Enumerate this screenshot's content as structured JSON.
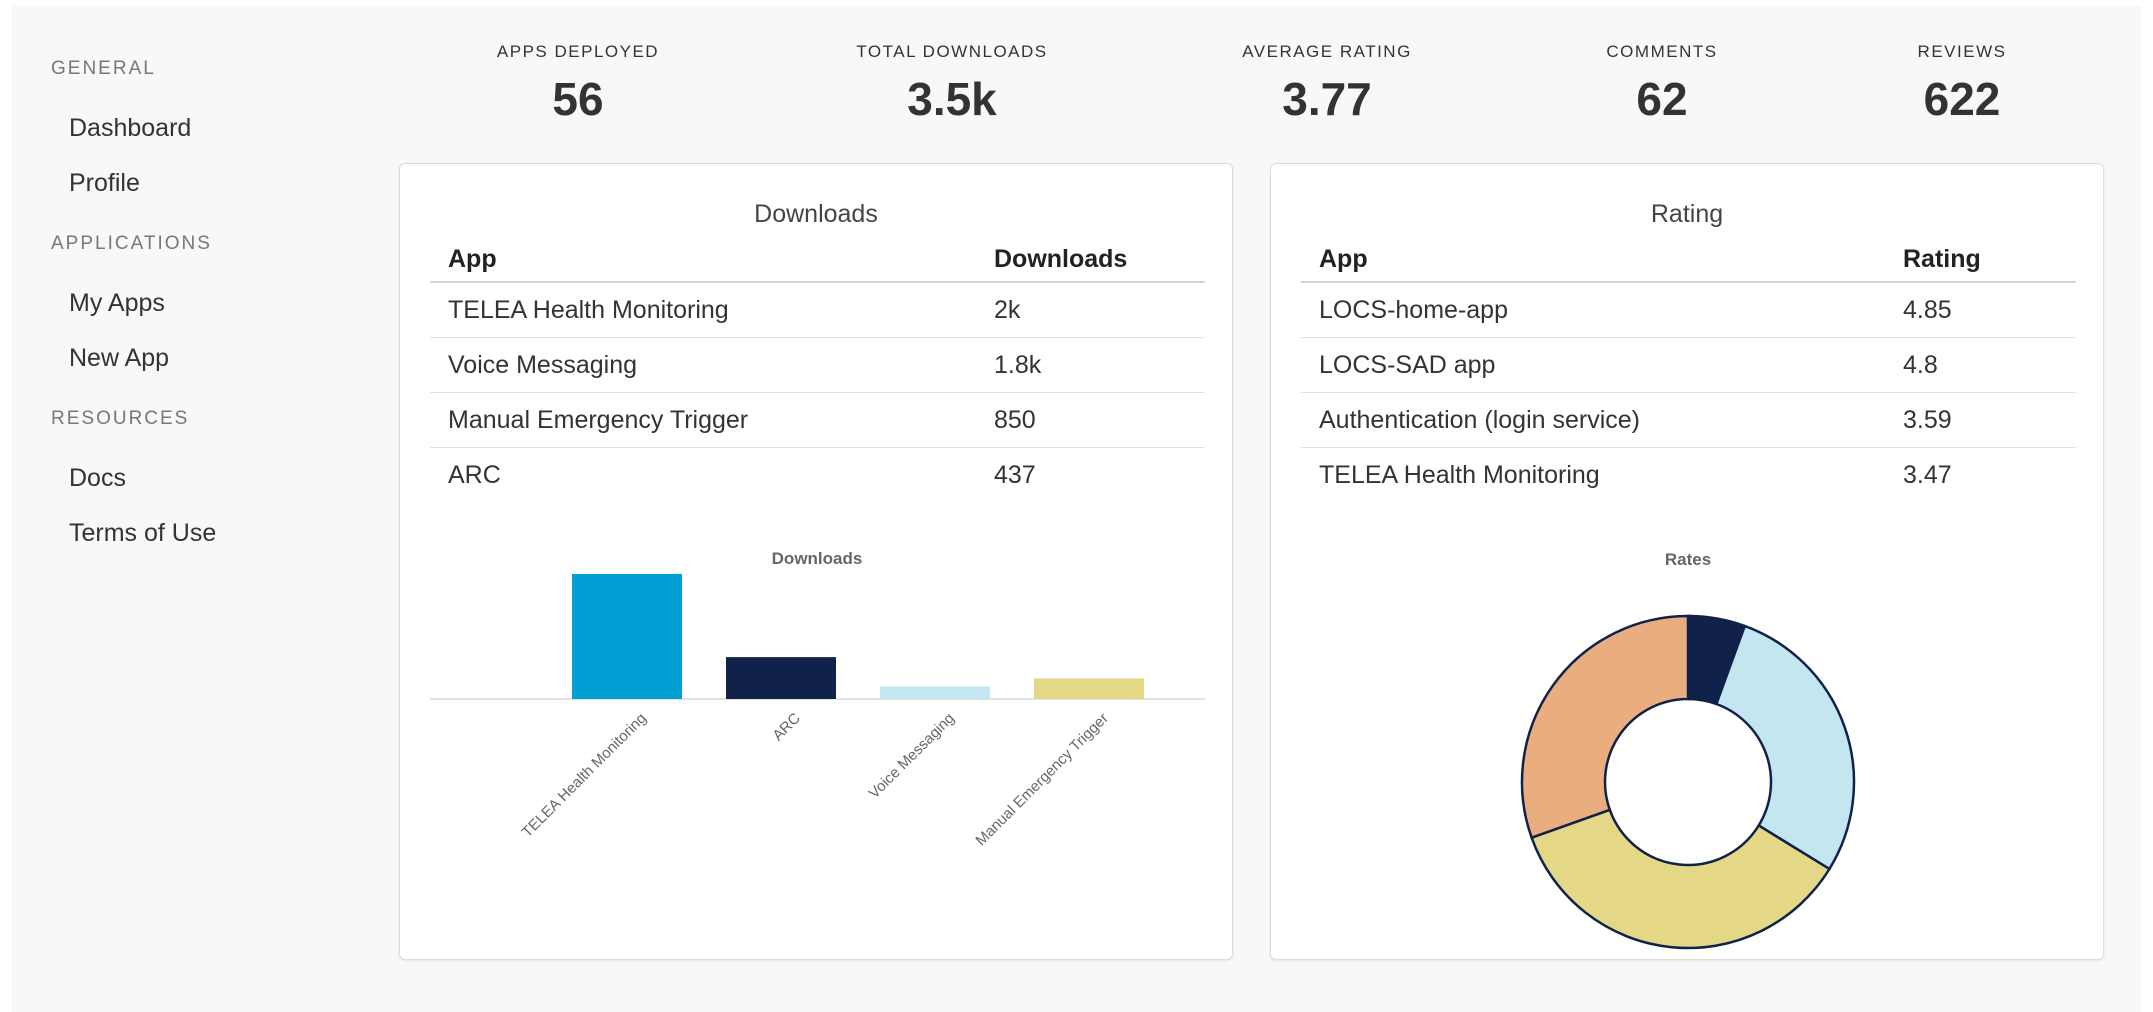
{
  "sidebar": {
    "sections": [
      {
        "title": "GENERAL",
        "items": [
          "Dashboard",
          "Profile"
        ]
      },
      {
        "title": "APPLICATIONS",
        "items": [
          "My Apps",
          "New App"
        ]
      },
      {
        "title": "RESOURCES",
        "items": [
          "Docs",
          "Terms of Use"
        ]
      }
    ]
  },
  "stats": [
    {
      "label": "APPS DEPLOYED",
      "value": "56"
    },
    {
      "label": "TOTAL DOWNLOADS",
      "value": "3.5k"
    },
    {
      "label": "AVERAGE RATING",
      "value": "3.77"
    },
    {
      "label": "COMMENTS",
      "value": "62"
    },
    {
      "label": "REVIEWS",
      "value": "622"
    }
  ],
  "downloads_card": {
    "title": "Downloads",
    "columns": [
      "App",
      "Downloads"
    ],
    "rows": [
      [
        "TELEA Health Monitoring",
        "2k"
      ],
      [
        "Voice Messaging",
        "1.8k"
      ],
      [
        "Manual Emergency Trigger",
        "850"
      ],
      [
        "ARC",
        "437"
      ]
    ]
  },
  "rating_card": {
    "title": "Rating",
    "columns": [
      "App",
      "Rating"
    ],
    "rows": [
      [
        "LOCS-home-app",
        "4.85"
      ],
      [
        "LOCS-SAD app",
        "4.8"
      ],
      [
        "Authentication (login service)",
        "3.59"
      ],
      [
        "TELEA Health Monitoring",
        "3.47"
      ]
    ]
  },
  "chart_data": [
    {
      "type": "bar",
      "title": "Downloads",
      "categories": [
        "TELEA Health Monitoring",
        "ARC",
        "Voice Messaging",
        "Manual Emergency Trigger"
      ],
      "values": [
        2000,
        670,
        200,
        330
      ],
      "colors": [
        "#009fd4",
        "#10214a",
        "#c4e6f1",
        "#e4d887"
      ],
      "grid": false
    },
    {
      "type": "pie",
      "title": "Rates",
      "values": [
        1,
        24,
        127,
        161,
        137
      ],
      "colors": [
        "#009fd4",
        "#10214a",
        "#c4e6f1",
        "#e4d887",
        "#e9ad80"
      ],
      "outline_color": "#10214a"
    }
  ]
}
